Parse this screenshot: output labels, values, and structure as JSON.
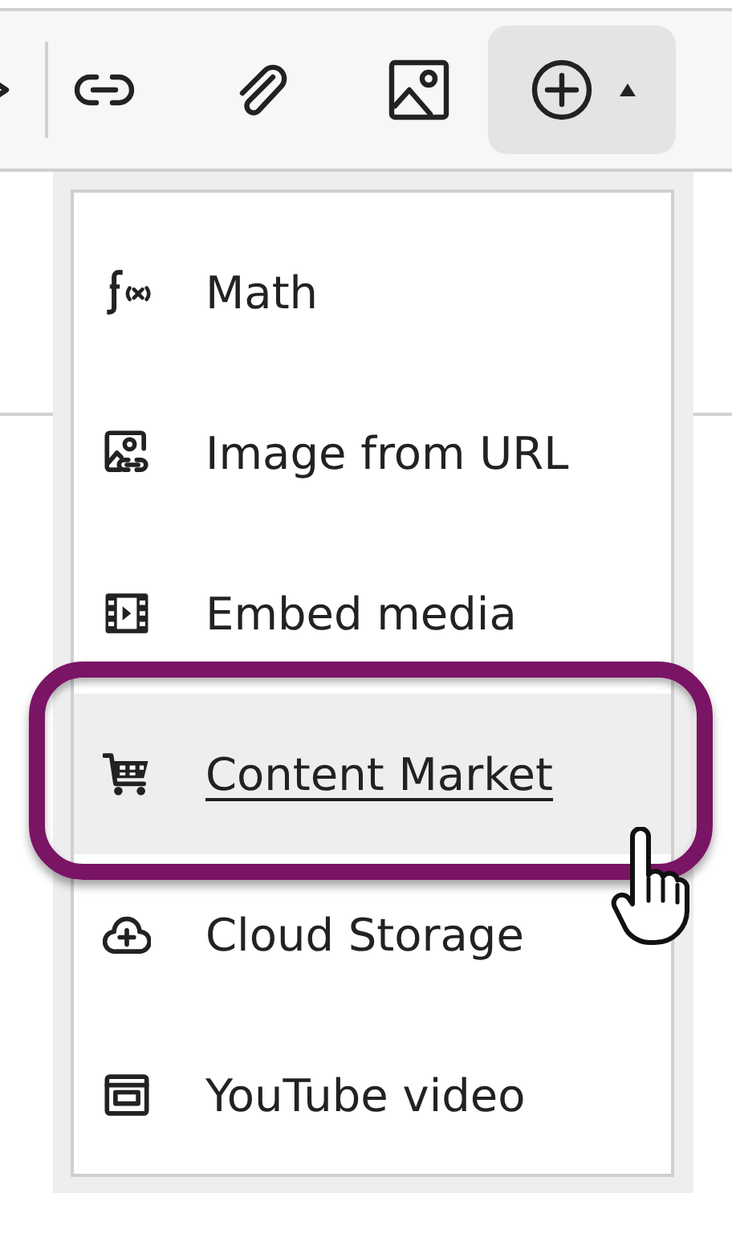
{
  "toolbar": {
    "buttons": [
      {
        "kind": "chevron",
        "selected": false
      },
      {
        "kind": "link",
        "selected": false
      },
      {
        "kind": "attach",
        "selected": false
      },
      {
        "kind": "image",
        "selected": false
      },
      {
        "kind": "insert",
        "selected": true
      }
    ]
  },
  "insert_menu": {
    "items": [
      {
        "kind": "math",
        "label": "Math",
        "selected": false
      },
      {
        "kind": "image-url",
        "label": "Image from URL",
        "selected": false
      },
      {
        "kind": "media",
        "label": "Embed media",
        "selected": false
      },
      {
        "kind": "cart",
        "label": "Content Market",
        "selected": true
      },
      {
        "kind": "cloud",
        "label": "Cloud Storage",
        "selected": false
      },
      {
        "kind": "video",
        "label": "YouTube video",
        "selected": false
      }
    ]
  }
}
